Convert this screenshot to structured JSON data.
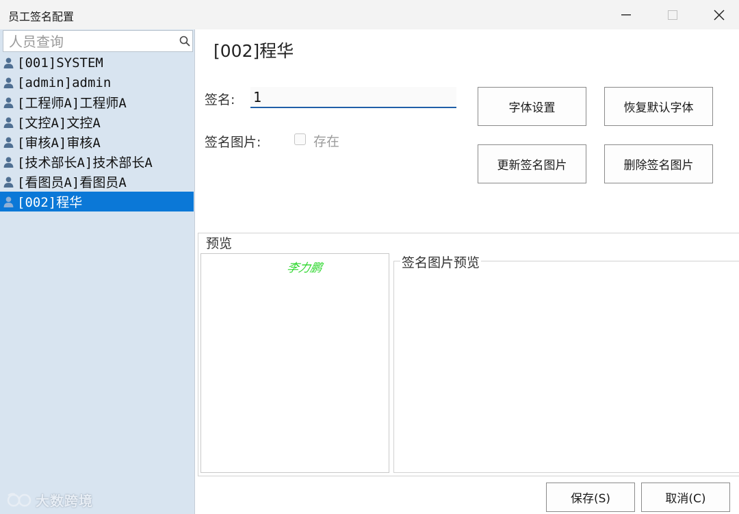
{
  "window": {
    "title": "员工签名配置"
  },
  "search": {
    "placeholder": "人员查询"
  },
  "users": [
    {
      "label": "[001]SYSTEM",
      "selected": false
    },
    {
      "label": "[admin]admin",
      "selected": false
    },
    {
      "label": "[工程师A]工程师A",
      "selected": false
    },
    {
      "label": "[文控A]文控A",
      "selected": false
    },
    {
      "label": "[审核A]审核A",
      "selected": false
    },
    {
      "label": "[技术部长A]技术部长A",
      "selected": false
    },
    {
      "label": "[看图员A]看图员A",
      "selected": false
    },
    {
      "label": "[002]程华",
      "selected": true
    }
  ],
  "watermark": "大数跨境",
  "detail": {
    "heading": "[002]程华",
    "signature_label": "签名:",
    "signature_value": "1",
    "image_label": "签名图片:",
    "exists_label": "存在",
    "exists_checked": false
  },
  "buttons": {
    "font_settings": "字体设置",
    "restore_default_font": "恢复默认字体",
    "update_image": "更新签名图片",
    "delete_image": "删除签名图片",
    "save": "保存(S)",
    "cancel": "取消(C)"
  },
  "preview": {
    "legend": "预览",
    "signature_text": "李力鹏",
    "image_preview_legend": "签名图片预览"
  },
  "colors": {
    "selected_row": "#0b78d7",
    "left_panel_bg": "#d8e4f0",
    "signature_ink": "#2ad62a"
  }
}
